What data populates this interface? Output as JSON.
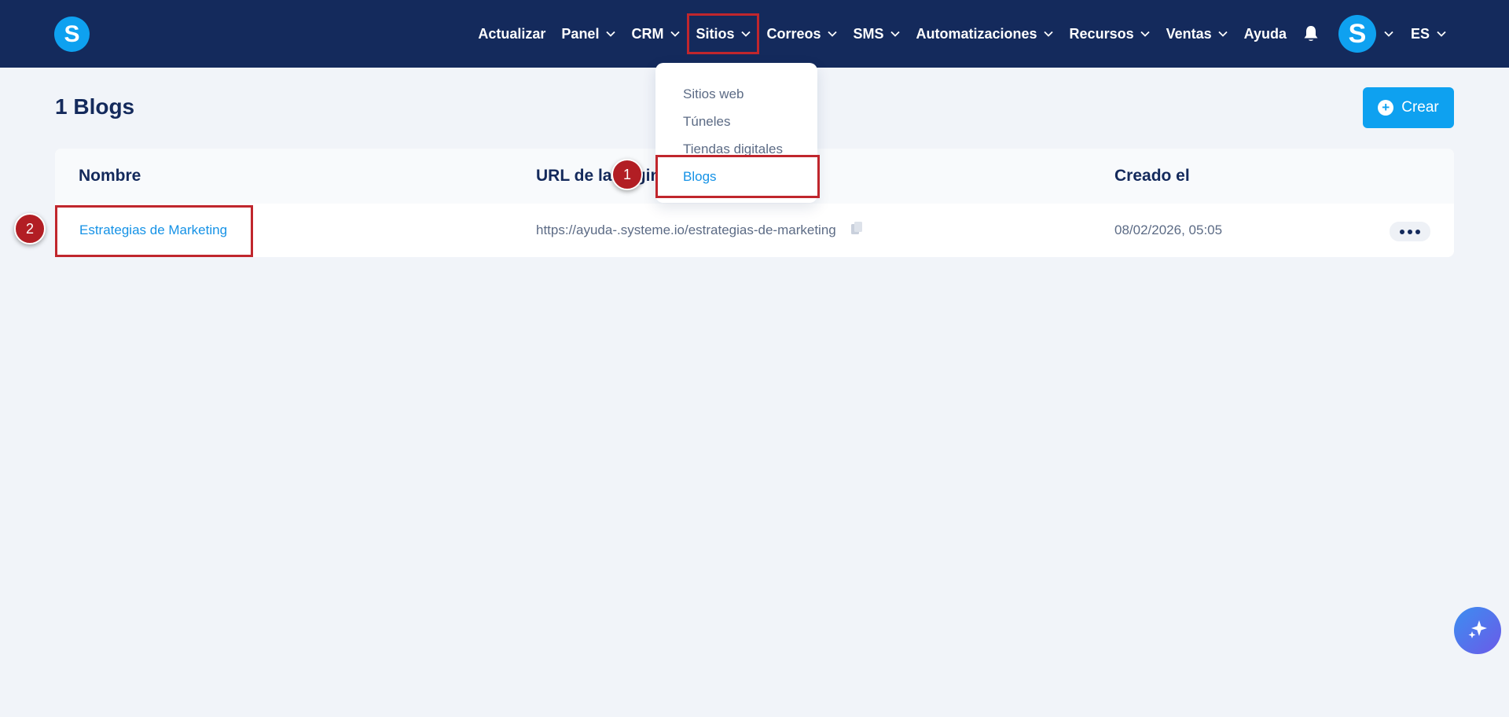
{
  "app": {
    "logo_letter": "S",
    "accent_color": "#0ea1f0",
    "nav_bg_color": "#142a5c"
  },
  "nav": {
    "items": [
      {
        "label": "Actualizar",
        "has_dropdown": false
      },
      {
        "label": "Panel",
        "has_dropdown": true
      },
      {
        "label": "CRM",
        "has_dropdown": true
      },
      {
        "label": "Sitios",
        "has_dropdown": true
      },
      {
        "label": "Correos",
        "has_dropdown": true
      },
      {
        "label": "SMS",
        "has_dropdown": true
      },
      {
        "label": "Automatizaciones",
        "has_dropdown": true
      },
      {
        "label": "Recursos",
        "has_dropdown": true
      },
      {
        "label": "Ventas",
        "has_dropdown": true
      },
      {
        "label": "Ayuda",
        "has_dropdown": false
      }
    ],
    "bell_icon": "bell-icon",
    "avatar_letter": "S",
    "language": "ES"
  },
  "sitios_menu": {
    "items": [
      {
        "label": "Sitios web"
      },
      {
        "label": "Túneles"
      },
      {
        "label": "Tiendas digitales"
      },
      {
        "label": "Blogs",
        "active": true
      }
    ]
  },
  "page": {
    "title": "1 Blogs",
    "create_label": "Crear"
  },
  "table": {
    "headers": {
      "name": "Nombre",
      "url": "URL de la página",
      "created": "Creado el"
    },
    "rows": [
      {
        "name": "Estrategias de Marketing",
        "url": "https://ayuda-.systeme.io/estrategias-de-marketing",
        "created": "08/02/2026, 05:05"
      }
    ]
  },
  "annotations": {
    "step1": "1",
    "step2": "2",
    "highlight_color": "#c0262d"
  }
}
